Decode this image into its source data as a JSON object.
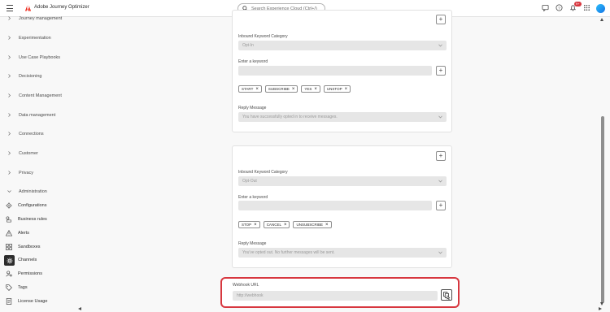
{
  "header": {
    "app_title": "Adobe Journey Optimizer",
    "search_placeholder": "Search Experience Cloud (Ctrl+/)",
    "notification_count": "9+"
  },
  "sidebar": {
    "sections": [
      {
        "label": "Journey management"
      },
      {
        "label": "Experimentation"
      },
      {
        "label": "Use Case Playbooks"
      },
      {
        "label": "Decisioning"
      },
      {
        "label": "Content Management"
      },
      {
        "label": "Data management"
      },
      {
        "label": "Connections"
      },
      {
        "label": "Customer"
      },
      {
        "label": "Privacy"
      },
      {
        "label": "Administration"
      }
    ],
    "admin_items": [
      {
        "label": "Configurations",
        "icon": "gear-icon"
      },
      {
        "label": "Business rules",
        "icon": "business-rules-icon"
      },
      {
        "label": "Alerts",
        "icon": "alert-icon"
      },
      {
        "label": "Sandboxes",
        "icon": "sandboxes-icon"
      },
      {
        "label": "Channels",
        "icon": "channels-icon",
        "active": true
      },
      {
        "label": "Permissions",
        "icon": "permissions-icon"
      },
      {
        "label": "Tags",
        "icon": "tag-icon"
      },
      {
        "label": "License Usage",
        "icon": "license-icon"
      }
    ]
  },
  "optin_card": {
    "category_label": "Inbound Keyword Category",
    "category_value": "Opt-In",
    "keyword_label": "Enter a keyword",
    "tags": [
      "START",
      "SUBSCRIBE",
      "YES",
      "UNSTOP"
    ],
    "reply_label": "Reply Message",
    "reply_value": "You have successfully opted in to receive messages."
  },
  "optout_card": {
    "category_label": "Inbound Keyword Category",
    "category_value": "Opt-Out",
    "keyword_label": "Enter a keyword",
    "tags": [
      "STOP",
      "CANCEL",
      "UNSUBSCRIBE"
    ],
    "reply_label": "Reply Message",
    "reply_value": "You've opted out. No further messages will be sent."
  },
  "webhook": {
    "label": "Webhook URL",
    "value": "http://webhook"
  },
  "colors": {
    "highlight": "#d7373f",
    "active_nav": "#2c2c2c",
    "brand": "#eb1000"
  }
}
